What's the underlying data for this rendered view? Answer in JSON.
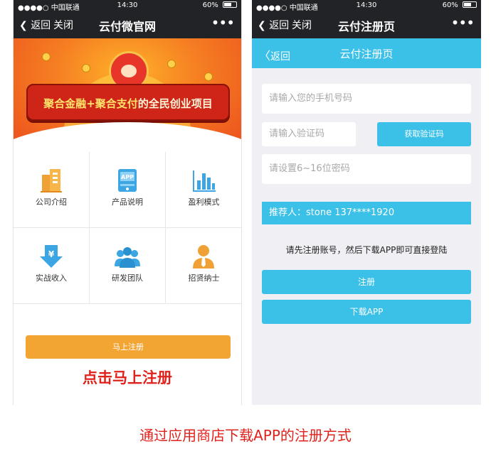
{
  "left_phone": {
    "status": {
      "carrier": "●●●●○ 中国联通",
      "time": "14:30",
      "battery": "60%",
      "battery_level": 0.6
    },
    "nav": {
      "back": "返回",
      "close": "关闭",
      "title": "云付微官网",
      "more": "•••"
    },
    "banner": {
      "slogan_a": "聚合金融+聚合支付",
      "slogan_b": "的全民创业项目"
    },
    "grid": [
      {
        "label": "公司介绍",
        "icon": "company-icon"
      },
      {
        "label": "产品说明",
        "icon": "app-icon",
        "icon_text": "APP"
      },
      {
        "label": "盈利模式",
        "icon": "bar-chart-icon"
      },
      {
        "label": "实战收入",
        "icon": "yen-download-icon",
        "icon_text": "¥"
      },
      {
        "label": "研发团队",
        "icon": "team-icon"
      },
      {
        "label": "招贤纳士",
        "icon": "recruit-icon"
      }
    ],
    "signup_button": "马上注册",
    "overlay_text": "点击马上注册"
  },
  "right_phone": {
    "status": {
      "carrier": "●●●●○ 中国联通",
      "time": "14:30",
      "battery": "60%",
      "battery_level": 0.6
    },
    "nav": {
      "back": "返回",
      "close": "关闭",
      "title": "云付注册页",
      "more": "•••"
    },
    "subbar": {
      "back": "返回",
      "title": "云付注册页"
    },
    "form": {
      "phone_placeholder": "请输入您的手机号码",
      "code_placeholder": "请输入验证码",
      "get_code": "获取验证码",
      "password_placeholder": "请设置6~16位密码"
    },
    "referrer": "推荐人：stone 137****1920",
    "hint": "请先注册账号，然后下载APP即可直接登陆",
    "register_button": "注册",
    "download_button": "下载APP"
  },
  "caption": "通过应用商店下载APP的注册方式",
  "colors": {
    "accent_blue": "#3bc0e8",
    "accent_orange": "#f3a533",
    "alert_red": "#e0221c",
    "nav_dark": "#222326"
  }
}
